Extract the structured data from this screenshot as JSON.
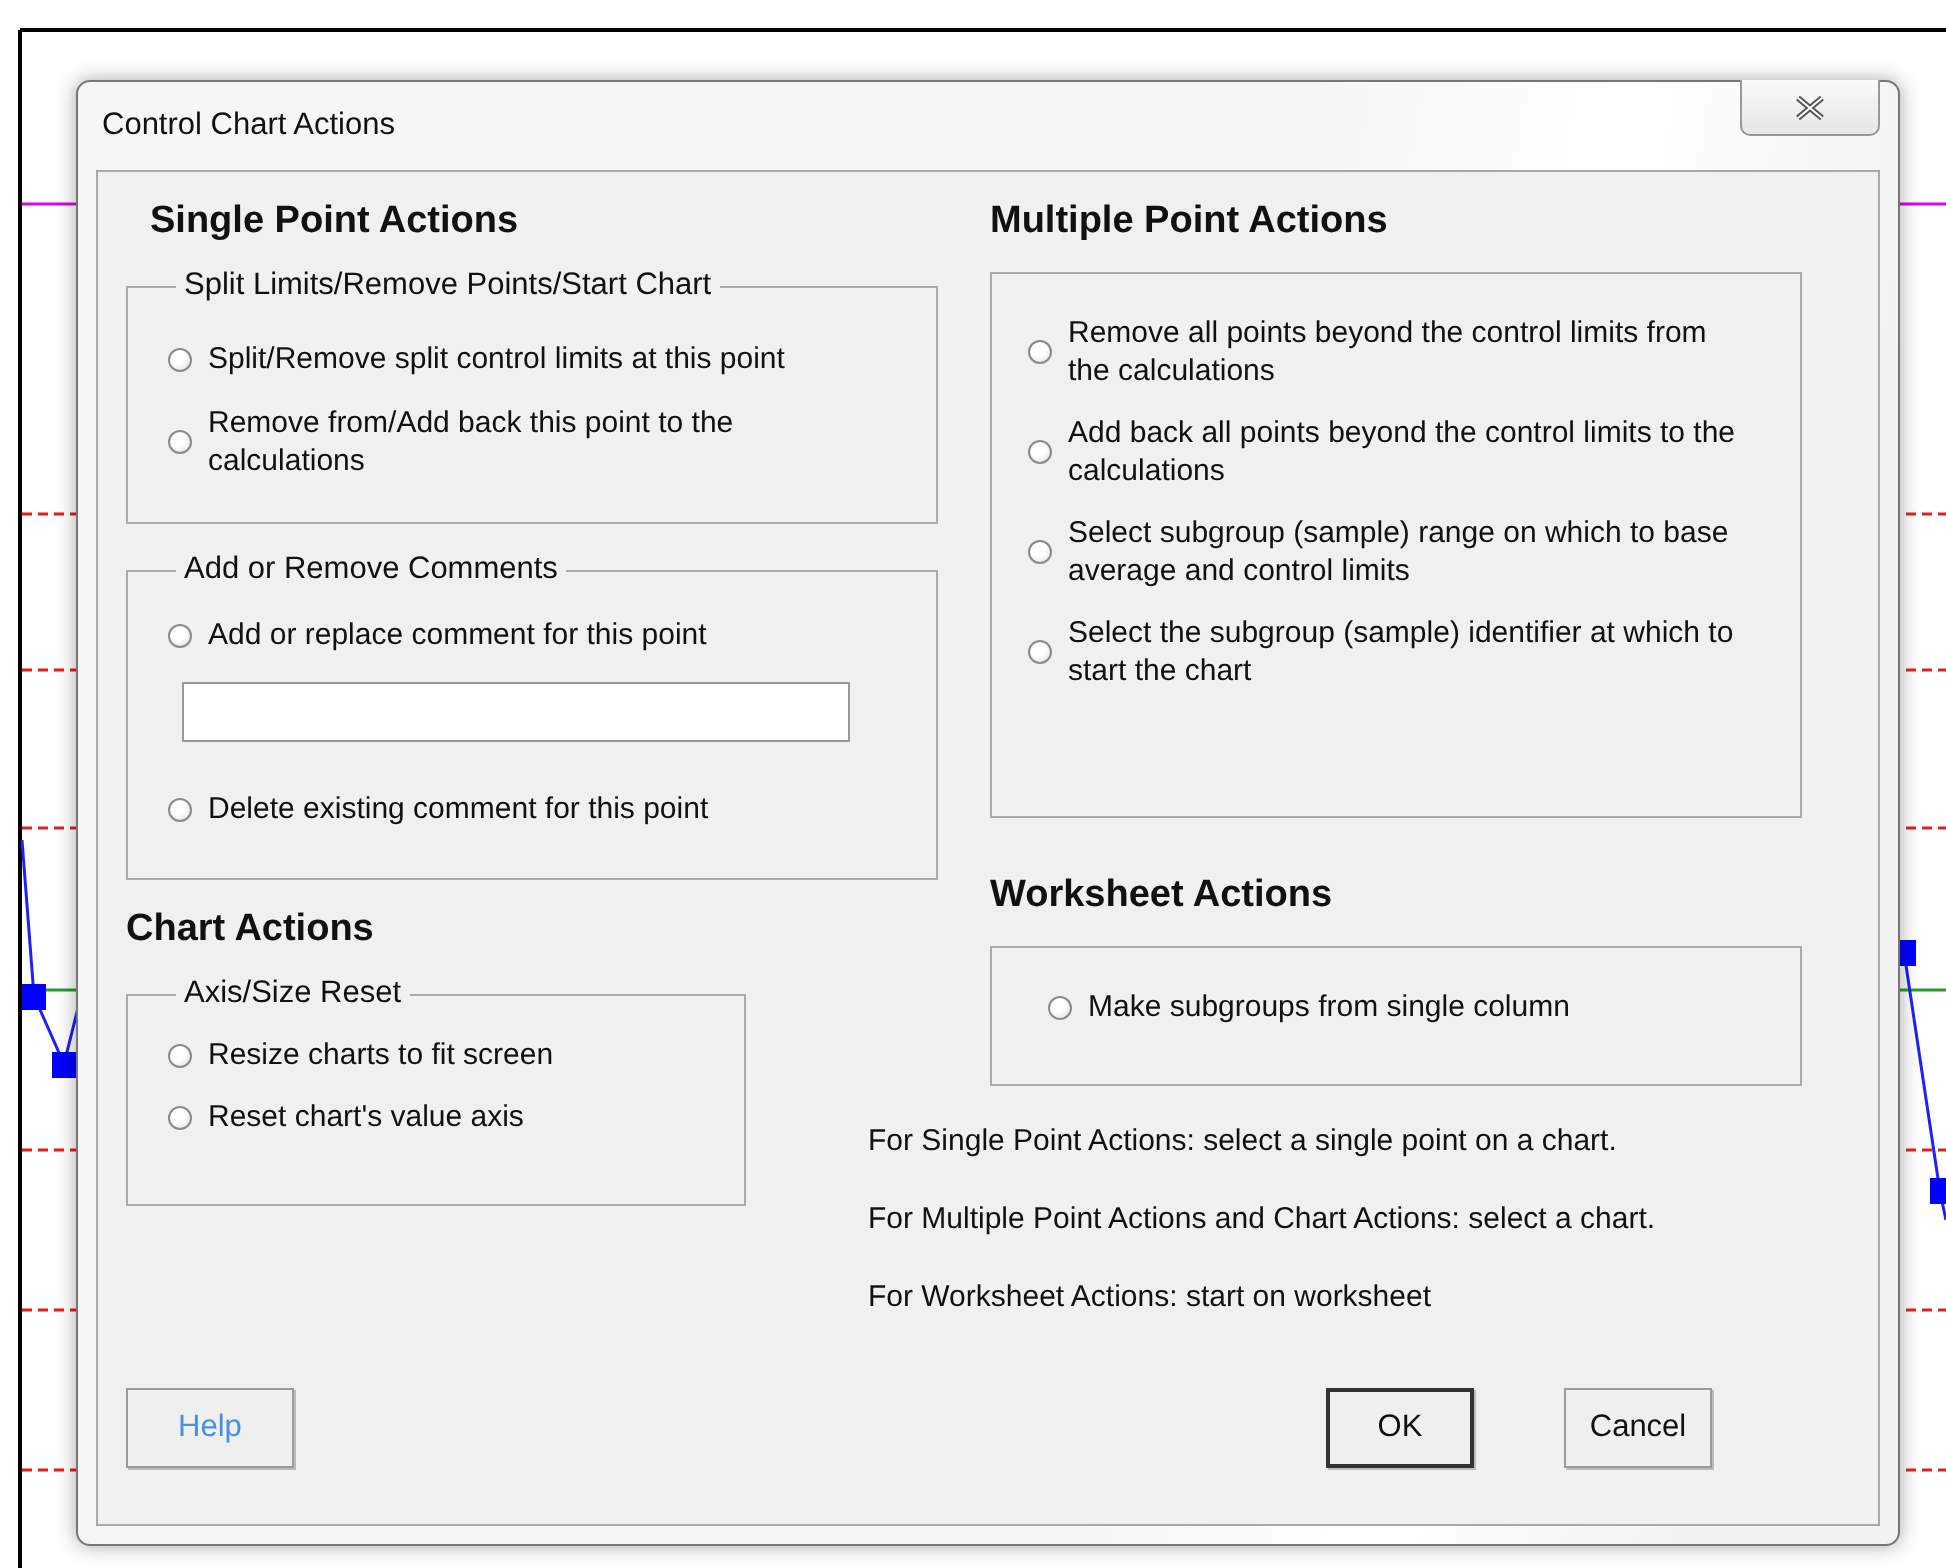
{
  "window": {
    "title": "Control Chart Actions"
  },
  "single_point_actions": {
    "heading": "Single Point Actions",
    "groups": [
      {
        "legend": "Split Limits/Remove Points/Start Chart",
        "items": [
          {
            "kind": "radio",
            "label": "Split/Remove split control limits at this point",
            "selected": false
          },
          {
            "kind": "radio",
            "label": "Remove from/Add back this point to the calculations",
            "selected": false
          }
        ]
      },
      {
        "legend": "Add or Remove Comments",
        "items": [
          {
            "kind": "radio",
            "label": "Add or replace comment for this point",
            "selected": false
          },
          {
            "kind": "field"
          },
          {
            "kind": "radio",
            "label": "Delete existing comment for this point",
            "selected": false
          }
        ]
      }
    ]
  },
  "chart_actions": {
    "heading": "Chart Actions",
    "groups": [
      {
        "legend": "Axis/Size Reset",
        "items": [
          {
            "kind": "radio",
            "label": "Resize charts to fit screen",
            "selected": false
          },
          {
            "kind": "radio",
            "label": "Reset chart's value axis",
            "selected": false
          }
        ]
      }
    ]
  },
  "multiple_point_actions": {
    "heading": "Multiple Point Actions",
    "items": [
      {
        "kind": "radio",
        "label": "Remove all points beyond the control limits from the calculations",
        "selected": false
      },
      {
        "kind": "radio",
        "label": "Add back all points beyond the control limits to the calculations",
        "selected": false
      },
      {
        "kind": "radio",
        "label": "Select subgroup (sample) range on which to base average and control limits",
        "selected": false
      },
      {
        "kind": "radio",
        "label": "Select the subgroup (sample) identifier at which to start the chart",
        "selected": false
      }
    ]
  },
  "worksheet_actions": {
    "heading": "Worksheet Actions",
    "items": [
      {
        "kind": "radio",
        "label": "Make subgroups from single column",
        "selected": false
      }
    ]
  },
  "notes": [
    "For Single Point Actions: select a single point on a chart.",
    "For Multiple Point Actions and Chart Actions: select a chart.",
    "For Worksheet Actions: start on worksheet"
  ],
  "buttons": [
    {
      "label": "Help",
      "kind": "help"
    },
    {
      "label": "OK",
      "kind": "default"
    },
    {
      "label": "Cancel",
      "kind": "normal"
    }
  ]
}
